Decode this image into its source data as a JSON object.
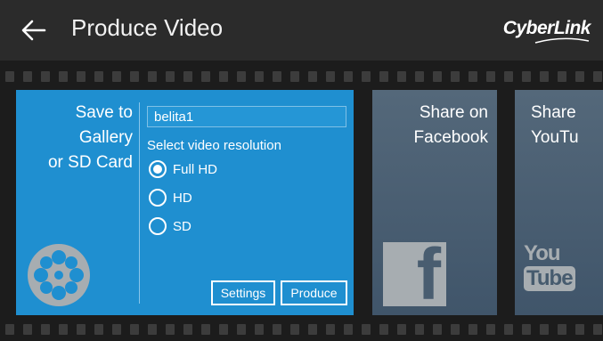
{
  "header": {
    "title": "Produce Video",
    "logo": "CyberLink"
  },
  "cards": {
    "save": {
      "title_line1": "Save to",
      "title_line2": "Gallery",
      "title_line3": "or SD Card",
      "filename": "belita1",
      "resolution_label": "Select video resolution",
      "options": [
        "Full HD",
        "HD",
        "SD"
      ],
      "selected": "Full HD",
      "settings_label": "Settings",
      "produce_label": "Produce"
    },
    "facebook": {
      "title_line1": "Share on",
      "title_line2": "Facebook",
      "icon": "facebook-icon"
    },
    "youtube": {
      "title_line1": "Share",
      "title_line2": "YouTu",
      "icon_line1": "You",
      "icon_line2": "Tube",
      "icon": "youtube-icon"
    }
  },
  "colors": {
    "accent": "#1f8fd0",
    "card_gray": "#4b5f72",
    "background": "#242424"
  },
  "icons": {
    "back": "arrow-left-icon",
    "film_reel": "film-reel-icon"
  }
}
